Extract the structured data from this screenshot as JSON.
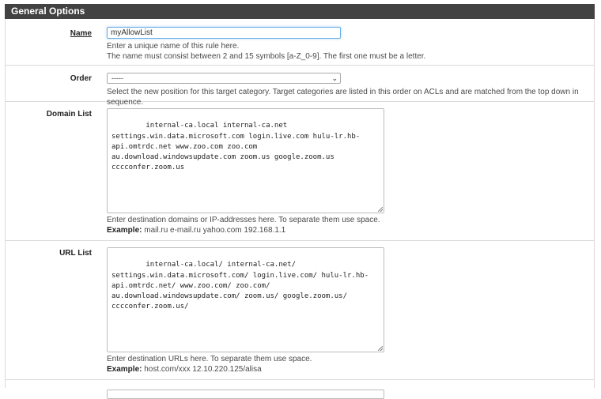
{
  "panel": {
    "title": "General Options"
  },
  "name_row": {
    "label": "Name",
    "value": "myAllowList",
    "help_line1": "Enter a unique name of this rule here.",
    "help_line2": "The name must consist between 2 and 15 symbols [a-Z_0-9]. The first one must be a letter."
  },
  "order_row": {
    "label": "Order",
    "selected": "-----",
    "help": "Select the new position for this target category. Target categories are listed in this order on ACLs and are matched from the top down in sequence."
  },
  "domain_row": {
    "label": "Domain List",
    "value": "internal-ca.local internal-ca.net\nsettings.win.data.microsoft.com login.live.com hulu-lr.hb-\napi.omtrdc.net www.zoo.com zoo.com\nau.download.windowsupdate.com zoom.us google.zoom.us\ncccconfer.zoom.us",
    "help": "Enter destination domains or IP-addresses here. To separate them use space.",
    "example_label": "Example:",
    "example_text": " mail.ru e-mail.ru yahoo.com 192.168.1.1"
  },
  "url_row": {
    "label": "URL List",
    "value": "internal-ca.local/ internal-ca.net/\nsettings.win.data.microsoft.com/ login.live.com/ hulu-lr.hb-\napi.omtrdc.net/ www.zoo.com/ zoo.com/\nau.download.windowsupdate.com/ zoom.us/ google.zoom.us/\ncccconfer.zoom.us/",
    "help": "Enter destination URLs here. To separate them use space.",
    "example_label": "Example:",
    "example_text": " host.com/xxx 12.10.220.125/alisa"
  },
  "icons": {
    "order_select": "chevron-down-icon",
    "resize": "resize-grip-icon"
  }
}
